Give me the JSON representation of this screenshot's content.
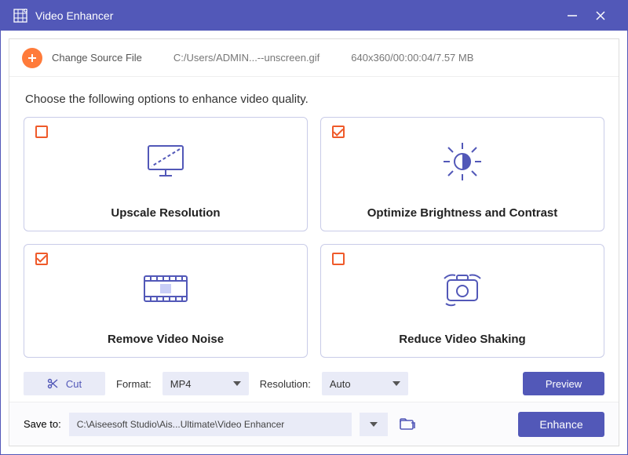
{
  "colors": {
    "brand": "#5258b8",
    "accent": "#ff7b3a",
    "check": "#ef5a2a"
  },
  "titlebar": {
    "title": "Video Enhancer"
  },
  "source": {
    "change_label": "Change Source File",
    "path": "C:/Users/ADMIN...--unscreen.gif",
    "meta": "640x360/00:00:04/7.57 MB"
  },
  "main": {
    "prompt": "Choose the following options to enhance video quality.",
    "cards": [
      {
        "id": "upscale",
        "title": "Upscale Resolution",
        "checked": false
      },
      {
        "id": "brightness",
        "title": "Optimize Brightness and Contrast",
        "checked": true
      },
      {
        "id": "denoise",
        "title": "Remove Video Noise",
        "checked": true
      },
      {
        "id": "deshake",
        "title": "Reduce Video Shaking",
        "checked": false
      }
    ]
  },
  "tools": {
    "cut_label": "Cut",
    "format_label": "Format:",
    "format_value": "MP4",
    "resolution_label": "Resolution:",
    "resolution_value": "Auto",
    "preview_label": "Preview"
  },
  "footer": {
    "save_label": "Save to:",
    "save_path": "C:\\Aiseesoft Studio\\Ais...Ultimate\\Video Enhancer",
    "enhance_label": "Enhance"
  }
}
